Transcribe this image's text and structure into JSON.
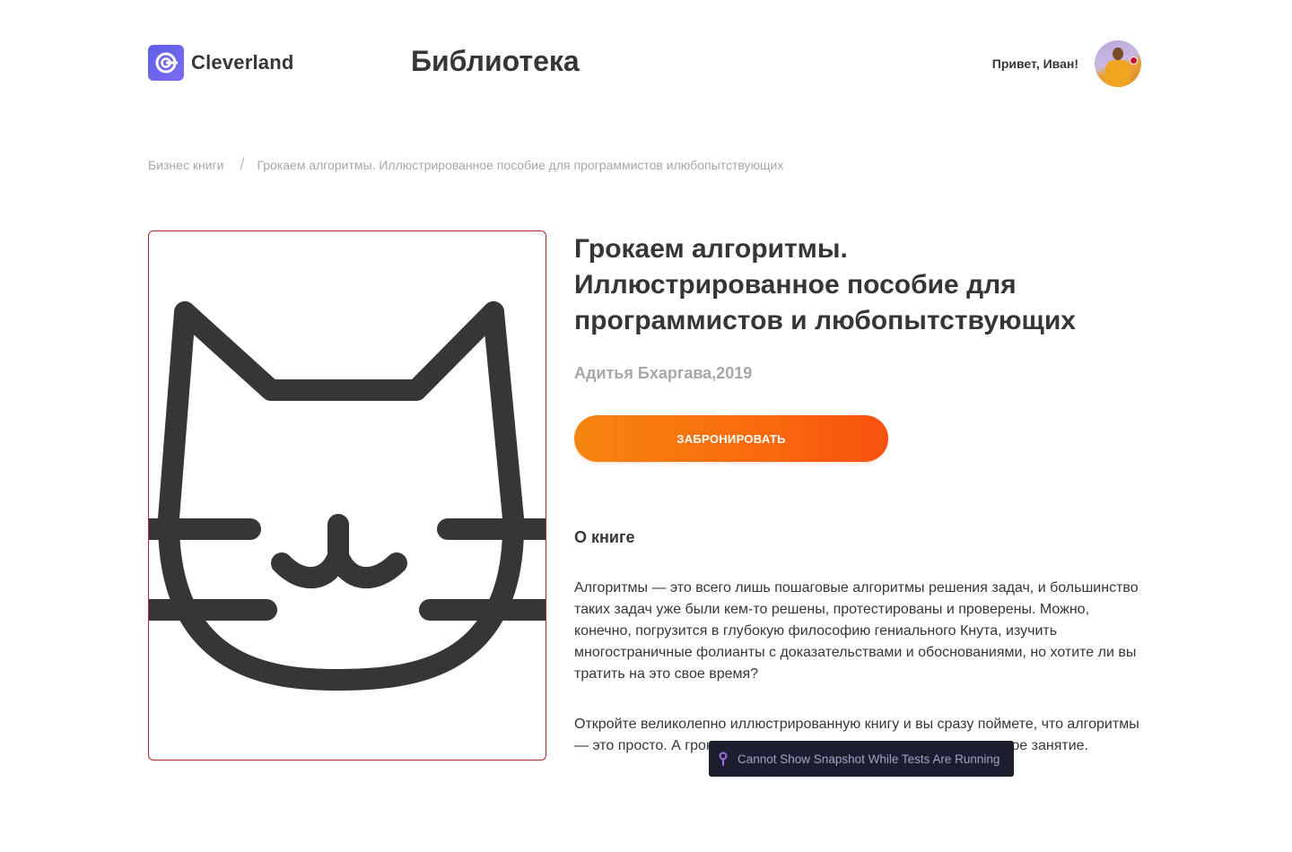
{
  "header": {
    "logo_text": "Cleverland",
    "page_title": "Библиотека",
    "greeting": "Привет, Иван!"
  },
  "breadcrumb": {
    "category": "Бизнес книги",
    "separator": "/",
    "current": "Грокаем алгоритмы. Иллюстрированное пособие для программистов илюбопытствующих"
  },
  "book": {
    "title": "Грокаем алгоритмы. Иллюстрированное пособие для программистов и любопытствующих",
    "author_year": "Адитья Бхаргава,2019",
    "book_button_label": "ЗАБРОНИРОВАТЬ",
    "about_heading": "О книге",
    "about_paragraphs": [
      "Алгоритмы — это всего лишь пошаговые алгоритмы решения задач, и большинство таких задач уже были кем-то решены, протестированы и проверены. Можно, конечно, погрузится в глубокую философию гениального Кнута, изучить многостраничные фолианты с доказательствами и обоснованиями, но хотите ли вы тратить на это свое время?",
      "Откройте великолепно иллюстрированную книгу и вы сразу поймете, что алгоритмы — это просто. А грокать алгоритмы — это веселое и увлекательное занятие."
    ]
  },
  "toast": {
    "text": "Cannot Show Snapshot While Tests Are Running"
  },
  "colors": {
    "accent_start": "#f68510",
    "accent_end": "#f8510f",
    "logo": "#6c63ef",
    "text": "#363636",
    "muted": "#a7a7a7",
    "cover_border": "#b3262b",
    "toast_bg": "#1b1e2e"
  },
  "icons": {
    "logo": "cleverland-logo-icon",
    "cover_placeholder": "cat-icon",
    "toast": "pin-icon"
  }
}
